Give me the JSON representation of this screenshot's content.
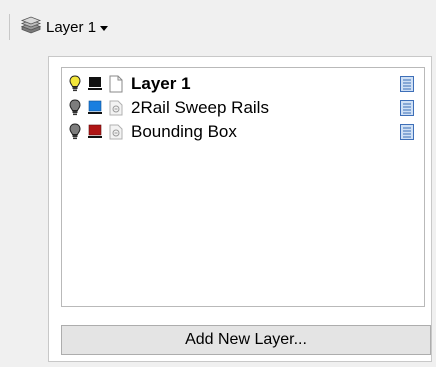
{
  "toolbar": {
    "current_layer_label": "Layer 1",
    "icon": "layer-stack-icon"
  },
  "layers": [
    {
      "name": "Layer 1",
      "bold": true,
      "bulb_state": "on",
      "bulb_color": "#f2e33a",
      "color": "#111111",
      "doc_icon": "document-icon",
      "material_icon": "material-icon"
    },
    {
      "name": "2Rail Sweep Rails",
      "bold": false,
      "bulb_state": "off",
      "bulb_color": "#7a7a7a",
      "color": "#1a7fe0",
      "doc_icon": "linked-document-icon",
      "material_icon": "material-icon"
    },
    {
      "name": "Bounding Box",
      "bold": false,
      "bulb_state": "off",
      "bulb_color": "#7a7a7a",
      "color": "#b01515",
      "doc_icon": "linked-document-icon",
      "material_icon": "material-icon"
    }
  ],
  "add_button": {
    "label": "Add New Layer..."
  }
}
